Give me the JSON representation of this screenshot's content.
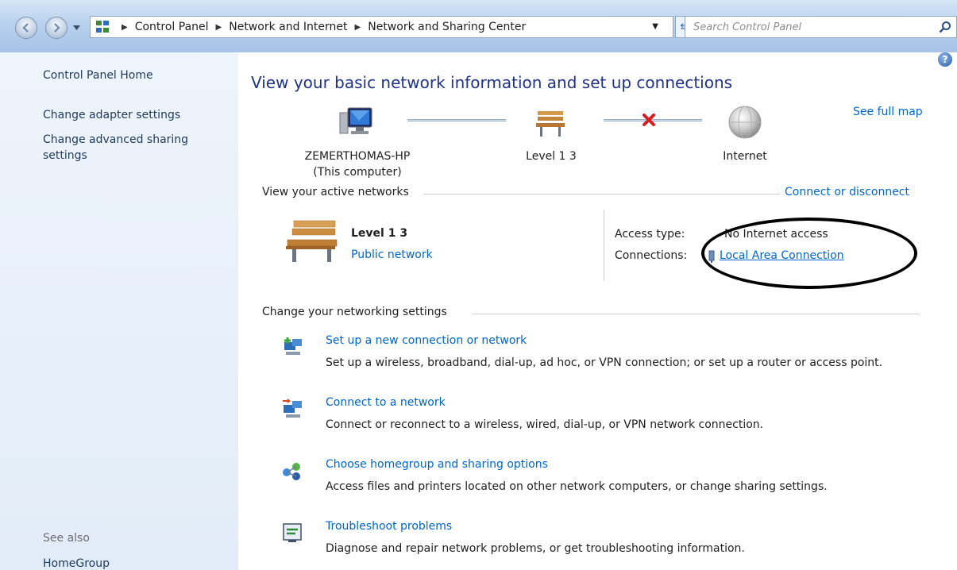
{
  "address_bar": {
    "crumbs": [
      "Control Panel",
      "Network and Internet",
      "Network and Sharing Center"
    ],
    "search_placeholder": "Search Control Panel"
  },
  "sidebar": {
    "items": [
      {
        "label": "Control Panel Home"
      },
      {
        "label": "Change adapter settings"
      },
      {
        "label": "Change advanced sharing settings"
      }
    ],
    "see_also": "See also",
    "see_also_items": [
      {
        "label": "HomeGroup"
      }
    ]
  },
  "main": {
    "title": "View your basic network information and set up connections",
    "see_full_map": "See full map",
    "map": {
      "computer_name": "ZEMERTHOMAS-HP",
      "computer_sub": "(This computer)",
      "network_name": "Level 1  3",
      "internet_label": "Internet"
    },
    "active_networks": {
      "header": "View your active networks",
      "connect_link": "Connect or disconnect",
      "network_name": "Level 1  3",
      "network_type": "Public network",
      "access_type_label": "Access type:",
      "access_type_value": "No Internet access",
      "connections_label": "Connections:",
      "connections_value": "Local Area Connection"
    },
    "settings": {
      "header": "Change your networking settings",
      "tasks": [
        {
          "icon": "new-connection-icon",
          "link": "Set up a new connection or network",
          "desc": "Set up a wireless, broadband, dial-up, ad hoc, or VPN connection; or set up a router or access point."
        },
        {
          "icon": "connect-network-icon",
          "link": "Connect to a network",
          "desc": "Connect or reconnect to a wireless, wired, dial-up, or VPN network connection."
        },
        {
          "icon": "homegroup-icon",
          "link": "Choose homegroup and sharing options",
          "desc": "Access files and printers located on other network computers, or change sharing settings."
        },
        {
          "icon": "troubleshoot-icon",
          "link": "Troubleshoot problems",
          "desc": "Diagnose and repair network problems, or get troubleshooting information."
        }
      ]
    }
  }
}
